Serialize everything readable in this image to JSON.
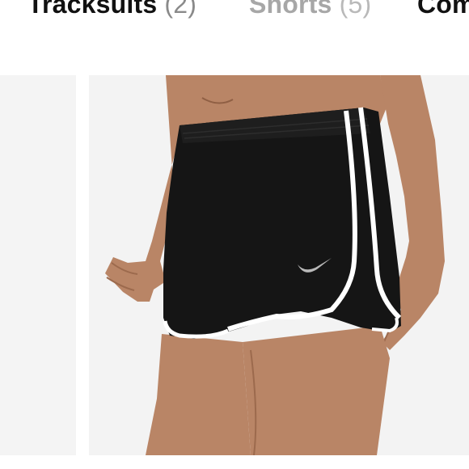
{
  "tabs": [
    {
      "label": "Tracksuits",
      "count": "(2)"
    },
    {
      "label": "Shorts",
      "count": "(5)"
    },
    {
      "label": "Com",
      "count": ""
    }
  ],
  "colors": {
    "skin": "#b98566",
    "skin_shadow": "#9c6a4d",
    "shorts": "#151515",
    "trim": "#ffffff",
    "logo": "#b9b9b9",
    "card_bg": "#f3f3f3"
  },
  "icons": {
    "brand_logo": "swoosh-icon"
  }
}
